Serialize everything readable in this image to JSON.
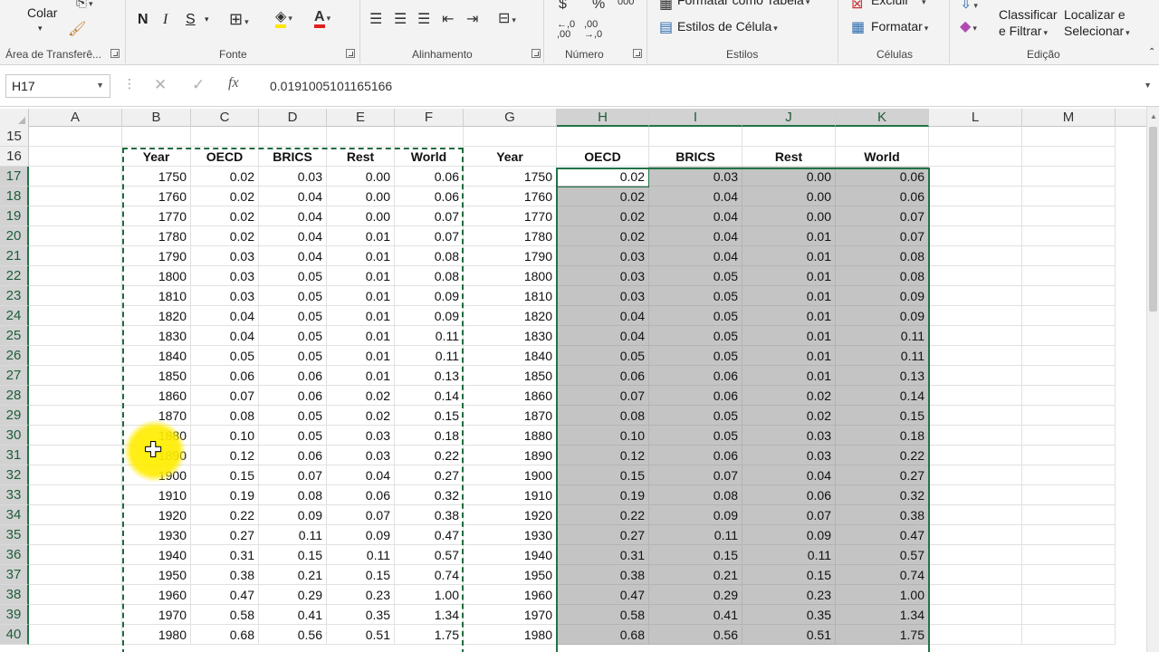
{
  "ribbon": {
    "clipboard": {
      "paste_label": "Colar",
      "group_label": "Área de Transferê..."
    },
    "font": {
      "group_label": "Fonte",
      "bold": "N",
      "italic": "I",
      "underline": "S"
    },
    "alignment": {
      "group_label": "Alinhamento"
    },
    "number": {
      "group_label": "Número",
      "currency": "$",
      "percent": "%",
      "thousands": "000",
      "inc_decimal": "←,0 ,00",
      "dec_decimal": ",00 →,0"
    },
    "styles": {
      "group_label": "Estilos",
      "format_as_table": "Formatar como Tabela",
      "cell_styles": "Estilos de Célula"
    },
    "cells": {
      "group_label": "Células",
      "delete": "Excluir",
      "format": "Formatar"
    },
    "editing": {
      "group_label": "Edição",
      "sort_filter_1": "Classificar",
      "sort_filter_2": "e Filtrar",
      "find_select_1": "Localizar e",
      "find_select_2": "Selecionar"
    }
  },
  "formula_bar": {
    "name_box": "H17",
    "cancel_icon": "✕",
    "enter_icon": "✓",
    "fx": "fx",
    "formula": "0.0191005101165166"
  },
  "columns": [
    "A",
    "B",
    "C",
    "D",
    "E",
    "F",
    "G",
    "H",
    "I",
    "J",
    "K",
    "L",
    "M"
  ],
  "selected_columns": [
    "H",
    "I",
    "J",
    "K"
  ],
  "active_cell": "H17",
  "headers_left": [
    "Year",
    "OECD",
    "BRICS",
    "Rest",
    "World"
  ],
  "headers_right": [
    "Year",
    "OECD",
    "BRICS",
    "Rest",
    "World"
  ],
  "header_row_numbers": [
    "15",
    "16"
  ],
  "data_rows": [
    {
      "row": "17",
      "year": "1750",
      "oecd": "0.02",
      "brics": "0.03",
      "rest": "0.00",
      "world": "0.06"
    },
    {
      "row": "18",
      "year": "1760",
      "oecd": "0.02",
      "brics": "0.04",
      "rest": "0.00",
      "world": "0.06"
    },
    {
      "row": "19",
      "year": "1770",
      "oecd": "0.02",
      "brics": "0.04",
      "rest": "0.00",
      "world": "0.07"
    },
    {
      "row": "20",
      "year": "1780",
      "oecd": "0.02",
      "brics": "0.04",
      "rest": "0.01",
      "world": "0.07"
    },
    {
      "row": "21",
      "year": "1790",
      "oecd": "0.03",
      "brics": "0.04",
      "rest": "0.01",
      "world": "0.08"
    },
    {
      "row": "22",
      "year": "1800",
      "oecd": "0.03",
      "brics": "0.05",
      "rest": "0.01",
      "world": "0.08"
    },
    {
      "row": "23",
      "year": "1810",
      "oecd": "0.03",
      "brics": "0.05",
      "rest": "0.01",
      "world": "0.09"
    },
    {
      "row": "24",
      "year": "1820",
      "oecd": "0.04",
      "brics": "0.05",
      "rest": "0.01",
      "world": "0.09"
    },
    {
      "row": "25",
      "year": "1830",
      "oecd": "0.04",
      "brics": "0.05",
      "rest": "0.01",
      "world": "0.11"
    },
    {
      "row": "26",
      "year": "1840",
      "oecd": "0.05",
      "brics": "0.05",
      "rest": "0.01",
      "world": "0.11"
    },
    {
      "row": "27",
      "year": "1850",
      "oecd": "0.06",
      "brics": "0.06",
      "rest": "0.01",
      "world": "0.13"
    },
    {
      "row": "28",
      "year": "1860",
      "oecd": "0.07",
      "brics": "0.06",
      "rest": "0.02",
      "world": "0.14"
    },
    {
      "row": "29",
      "year": "1870",
      "oecd": "0.08",
      "brics": "0.05",
      "rest": "0.02",
      "world": "0.15"
    },
    {
      "row": "30",
      "year": "1880",
      "oecd": "0.10",
      "brics": "0.05",
      "rest": "0.03",
      "world": "0.18"
    },
    {
      "row": "31",
      "year": "1890",
      "oecd": "0.12",
      "brics": "0.06",
      "rest": "0.03",
      "world": "0.22"
    },
    {
      "row": "32",
      "year": "1900",
      "oecd": "0.15",
      "brics": "0.07",
      "rest": "0.04",
      "world": "0.27"
    },
    {
      "row": "33",
      "year": "1910",
      "oecd": "0.19",
      "brics": "0.08",
      "rest": "0.06",
      "world": "0.32"
    },
    {
      "row": "34",
      "year": "1920",
      "oecd": "0.22",
      "brics": "0.09",
      "rest": "0.07",
      "world": "0.38"
    },
    {
      "row": "35",
      "year": "1930",
      "oecd": "0.27",
      "brics": "0.11",
      "rest": "0.09",
      "world": "0.47"
    },
    {
      "row": "36",
      "year": "1940",
      "oecd": "0.31",
      "brics": "0.15",
      "rest": "0.11",
      "world": "0.57"
    },
    {
      "row": "37",
      "year": "1950",
      "oecd": "0.38",
      "brics": "0.21",
      "rest": "0.15",
      "world": "0.74"
    },
    {
      "row": "38",
      "year": "1960",
      "oecd": "0.47",
      "brics": "0.29",
      "rest": "0.23",
      "world": "1.00"
    },
    {
      "row": "39",
      "year": "1970",
      "oecd": "0.58",
      "brics": "0.41",
      "rest": "0.35",
      "world": "1.34"
    },
    {
      "row": "40",
      "year": "1980",
      "oecd": "0.68",
      "brics": "0.56",
      "rest": "0.51",
      "world": "1.75"
    }
  ],
  "colors": {
    "excel_green": "#217346",
    "shade": "#c4c4c4",
    "cursor_highlight": "#ffe600"
  }
}
